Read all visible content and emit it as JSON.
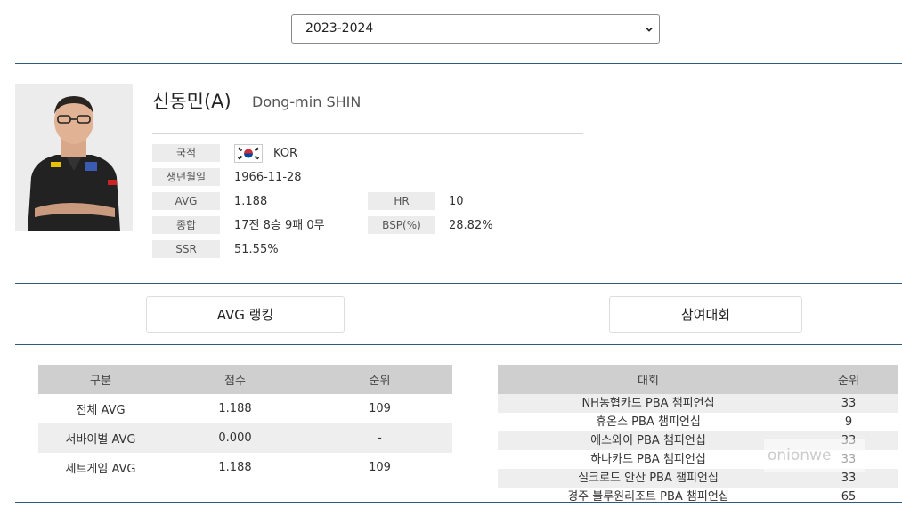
{
  "season": {
    "selected": "2023-2024"
  },
  "player": {
    "name_kr": "신동민(A)",
    "name_en": "Dong-min SHIN",
    "fields": {
      "nationality_label": "국적",
      "nationality_value": "KOR",
      "flag_icon": "korea-flag-icon",
      "birth_label": "생년월일",
      "birth_value": "1966-11-28",
      "avg_label": "AVG",
      "avg_value": "1.188",
      "hr_label": "HR",
      "hr_value": "10",
      "record_label": "종합",
      "record_value": "17전 8승 9패 0무",
      "bsp_label": "BSP(%)",
      "bsp_value": "28.82%",
      "ssr_label": "SSR",
      "ssr_value": "51.55%"
    }
  },
  "buttons": {
    "avg_ranking": "AVG 랭킹",
    "tournaments": "참여대회"
  },
  "avg_table": {
    "headers": [
      "구분",
      "점수",
      "순위"
    ],
    "rows": [
      [
        "전체 AVG",
        "1.188",
        "109"
      ],
      [
        "서바이벌 AVG",
        "0.000",
        "-"
      ],
      [
        "세트게임 AVG",
        "1.188",
        "109"
      ]
    ]
  },
  "tournament_table": {
    "headers": [
      "대회",
      "순위"
    ],
    "rows": [
      [
        "NH농협카드 PBA 챔피언십",
        "33"
      ],
      [
        "휴온스 PBA 챔피언십",
        "9"
      ],
      [
        "에스와이 PBA 챔피언십",
        "33"
      ],
      [
        "하나카드 PBA 챔피언십",
        "33"
      ],
      [
        "실크로드 안산 PBA 챔피언십",
        "33"
      ],
      [
        "경주 블루원리조트 PBA 챔피언십",
        "65"
      ]
    ]
  },
  "watermark": "onionwe",
  "colors": {
    "rule": "#2f5a7a",
    "header_bg": "#cfcfcf",
    "label_bg": "#ececec"
  }
}
